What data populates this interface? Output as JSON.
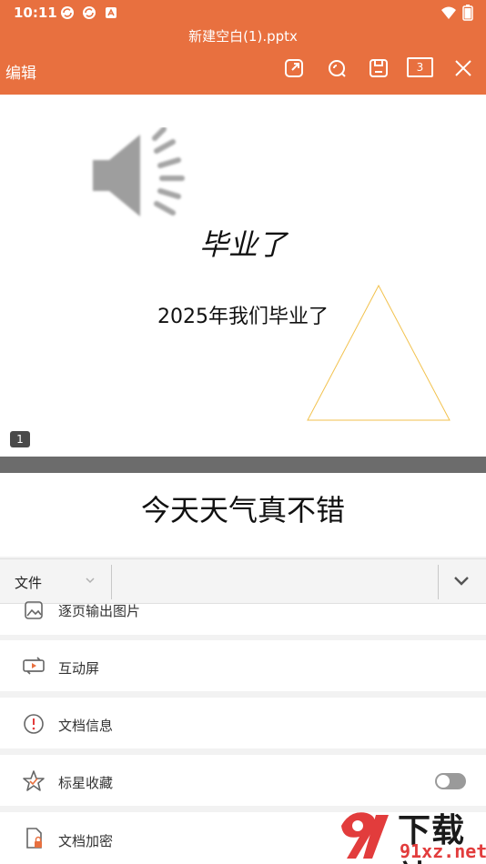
{
  "status_bar": {
    "time": "10:11"
  },
  "header": {
    "file_title": "新建空白(1).pptx",
    "edit_label": "编辑",
    "tabs_count": "3",
    "bg_color": "#e8703f"
  },
  "slides": [
    {
      "number": "1",
      "title": "毕业了",
      "subtitle": "2025年我们毕业了"
    },
    {
      "text": "今天天气真不错"
    }
  ],
  "menu_bar": {
    "file_label": "文件"
  },
  "menu_items": [
    {
      "label": "逐页输出图片",
      "icon": "image-export-icon"
    },
    {
      "label": "互动屏",
      "icon": "interactive-screen-icon"
    },
    {
      "label": "文档信息",
      "icon": "info-icon"
    },
    {
      "label": "标星收藏",
      "icon": "star-icon",
      "toggle": false
    },
    {
      "label": "文档加密",
      "icon": "lock-document-icon"
    }
  ],
  "watermark": {
    "cn": "下载站",
    "en": "91xz.net"
  }
}
